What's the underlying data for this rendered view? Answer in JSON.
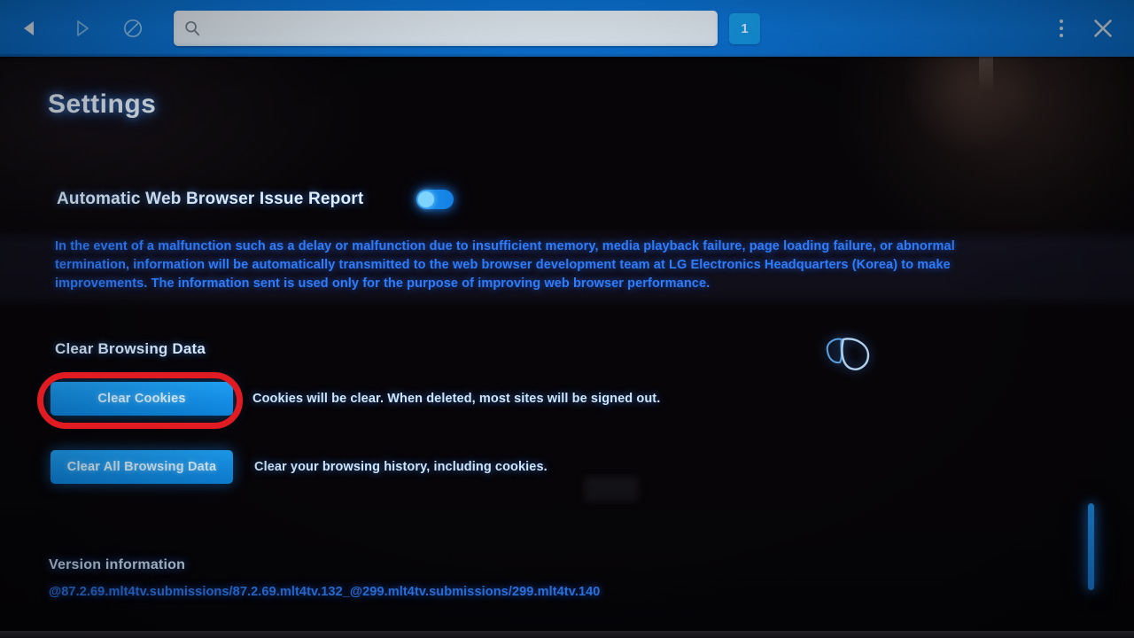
{
  "browser": {
    "toolbar": {
      "back_icon": "back-arrow-icon",
      "forward_icon": "forward-arrow-icon",
      "stop_icon": "stop-block-icon",
      "search_icon": "search-icon",
      "search_value": "",
      "search_placeholder": "",
      "tab_count_label": "1",
      "menu_icon": "kebab-menu-icon",
      "close_icon": "close-icon",
      "bar_color": "#0d78dd",
      "badge_color": "#19a2ee"
    }
  },
  "page": {
    "title": "Settings",
    "setting": {
      "label": "Automatic Web Browser Issue Report",
      "toggle_state": "on",
      "toggle_color": "#1a8ff0",
      "knob_color": "#7fd4ff"
    },
    "info_paragraph": "In the event of a malfunction such as a delay or malfunction due to insufficient memory, media playback failure, page loading failure, or abnormal termination, information will be automatically transmitted to the web browser development team at LG Electronics Headquarters (Korea) to make improvements. The information sent is used only for the purpose of improving web browser performance.",
    "section_heading": "Clear Browsing Data",
    "actions": [
      {
        "button_label": "Clear Cookies",
        "description": "Cookies will be clear. When deleted, most sites will be signed out."
      },
      {
        "button_label": "Clear All Browsing Data",
        "description": "Clear your browsing history, including cookies."
      }
    ],
    "version_heading": "Version information",
    "version_string": "@87.2.69.mlt4tv.submissions/87.2.69.mlt4tv.132_@299.mlt4tv.submissions/299.mlt4tv.140",
    "watermark_icon": "leaf-logo-icon",
    "scrollbar_icon": "vertical-scroll-indicator"
  },
  "annotation": {
    "shape": "oval-highlight",
    "color": "#e01b22",
    "targets": "clear-cookies-button"
  }
}
